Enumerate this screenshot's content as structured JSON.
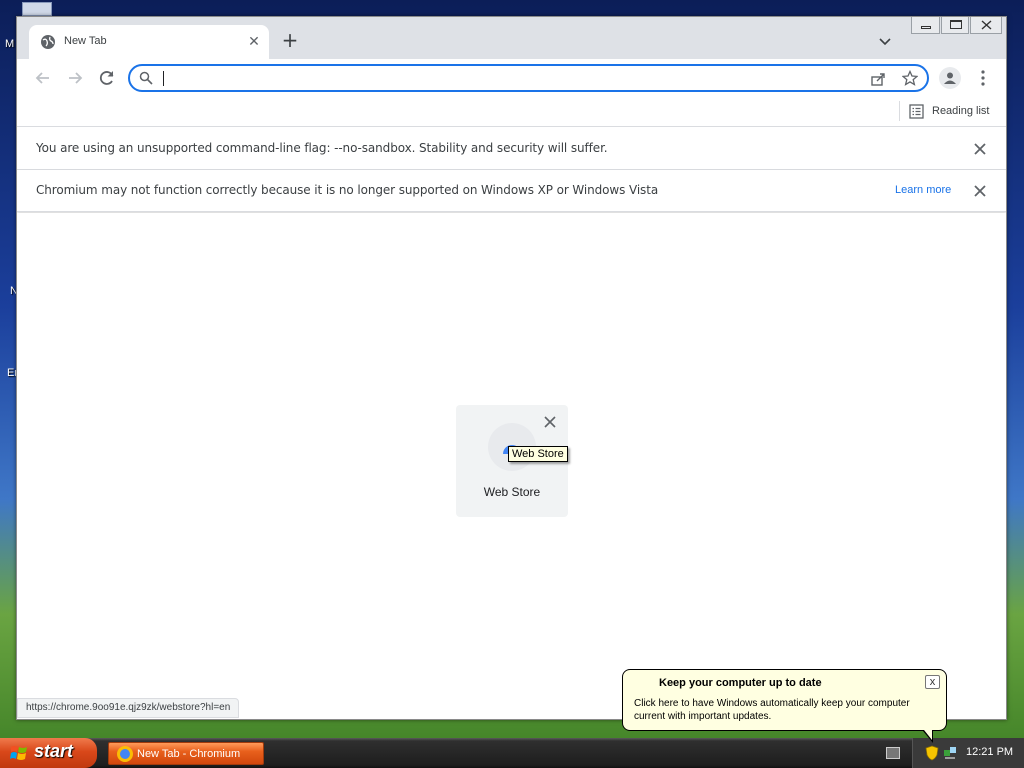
{
  "desktop": {
    "fragments": [
      "M",
      "N",
      "Er"
    ]
  },
  "browser": {
    "tab": {
      "title": "New Tab",
      "close_label": "✕",
      "icon": "globe-icon"
    },
    "new_tab_label": "+",
    "omnibox": {
      "value": "",
      "placeholder": ""
    },
    "bookmarks": {
      "reading_list_label": "Reading list"
    },
    "infobars": [
      {
        "text": "You are using an unsupported command-line flag: --no-sandbox. Stability and security will suffer."
      },
      {
        "text": "Chromium may not function correctly because it is no longer supported on Windows XP or Windows Vista",
        "link": "Learn more"
      }
    ],
    "shortcut": {
      "title": "Web Store",
      "tooltip": "Web Store"
    },
    "status_url": "https://chrome.9oo91e.qjz9zk/webstore?hl=en"
  },
  "taskbar": {
    "start_label": "start",
    "task_label": "New Tab - Chromium",
    "clock": "12:21 PM"
  },
  "balloon": {
    "title": "Keep your computer up to date",
    "body": "Click here to have Windows automatically keep your computer current with important updates.",
    "close_label": "x"
  },
  "colors": {
    "accent": "#1a73e8",
    "start_button": "#d9481a",
    "balloon_bg": "#ffffe1"
  }
}
